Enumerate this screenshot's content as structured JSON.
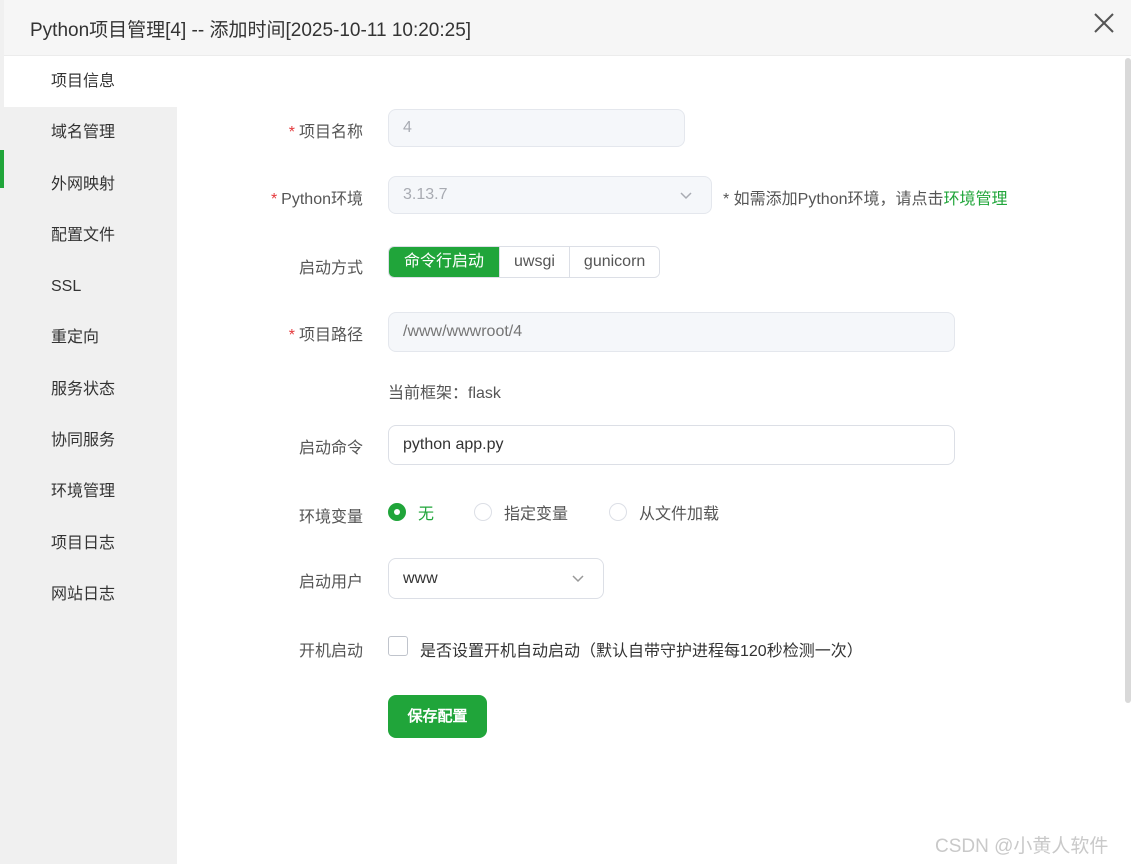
{
  "window": {
    "title": "Python项目管理[4] -- 添加时间[2025-10-11 10:20:25]"
  },
  "sidebar": {
    "items": [
      {
        "label": "项目信息",
        "active": true
      },
      {
        "label": "域名管理"
      },
      {
        "label": "外网映射"
      },
      {
        "label": "配置文件"
      },
      {
        "label": "SSL"
      },
      {
        "label": "重定向"
      },
      {
        "label": "服务状态"
      },
      {
        "label": "协同服务"
      },
      {
        "label": "环境管理"
      },
      {
        "label": "项目日志"
      },
      {
        "label": "网站日志"
      }
    ]
  },
  "form": {
    "required_mark": "*",
    "project_name": {
      "label": "项目名称",
      "value": "4"
    },
    "python_env": {
      "label": "Python环境",
      "value": "3.13.7",
      "hint_prefix": "* 如需添加Python环境，请点击",
      "hint_link": "环境管理"
    },
    "start_mode": {
      "label": "启动方式",
      "options": [
        "命令行启动",
        "uwsgi",
        "gunicorn"
      ],
      "selected": "命令行启动"
    },
    "project_path": {
      "label": "项目路径",
      "placeholder": "/www/wwwroot/4"
    },
    "framework": {
      "text": "当前框架：flask"
    },
    "start_command": {
      "label": "启动命令",
      "value": "python app.py"
    },
    "env_vars": {
      "label": "环境变量",
      "options": [
        "无",
        "指定变量",
        "从文件加载"
      ],
      "selected": "无"
    },
    "start_user": {
      "label": "启动用户",
      "value": "www"
    },
    "autostart": {
      "label": "开机启动",
      "checkbox_text": "是否设置开机自动启动（默认自带守护进程每120秒检测一次）",
      "checked": false
    },
    "save_label": "保存配置"
  },
  "watermark": "CSDN @小黄人软件",
  "colors": {
    "accent": "#20a53a",
    "required": "#e4393c",
    "sidebar_bg": "#f0f0f0"
  }
}
